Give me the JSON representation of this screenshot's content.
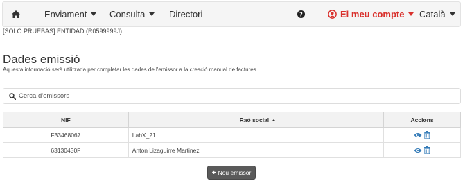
{
  "navbar": {
    "home_icon": "home-icon",
    "items": [
      {
        "label": "Enviament",
        "dropdown": true
      },
      {
        "label": "Consulta",
        "dropdown": true
      },
      {
        "label": "Directori",
        "dropdown": false
      }
    ],
    "help_icon": "question-circle-icon",
    "account": {
      "label": "El meu compte",
      "icon": "user-circle-icon",
      "color": "#d9302c"
    },
    "language": {
      "label": "Català"
    }
  },
  "entity": "[SOLO PRUEBAS] ENTIDAD (R0599999J)",
  "page": {
    "title": "Dades emissió",
    "subtitle": "Aquesta informació serà utilitzada per completar les dades de l'emissor a la creació manual de factures."
  },
  "search": {
    "label": "Cerca d'emissors",
    "icon": "search-icon"
  },
  "table": {
    "columns": [
      "NIF",
      "Raó social",
      "Accions"
    ],
    "sorted_column": "Raó social",
    "sort_direction": "ascending",
    "rows": [
      {
        "nif": "F33468067",
        "rao_social": "LabX_21"
      },
      {
        "nif": "63130430F",
        "rao_social": "Anton Lizaguirre Martinez"
      }
    ],
    "action_icons": [
      "eye-icon",
      "trash-icon"
    ],
    "action_color": "#337ab7"
  },
  "new_button": {
    "label": "Nou emissor",
    "icon": "plus-icon"
  }
}
